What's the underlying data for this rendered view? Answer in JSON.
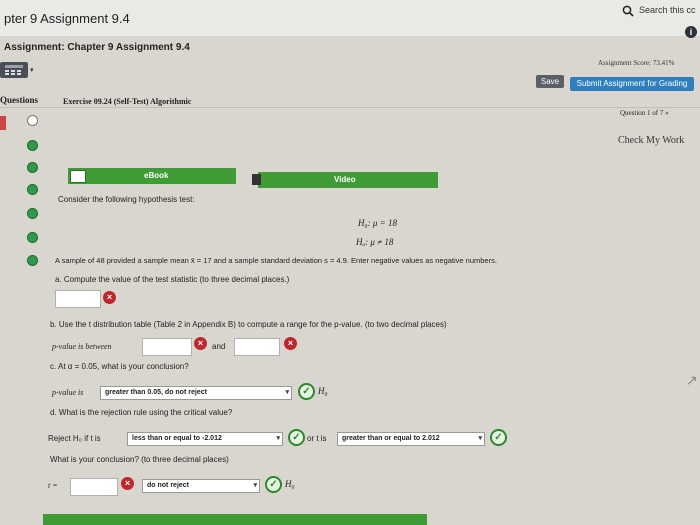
{
  "browser": {
    "search_placeholder": "Search this cc"
  },
  "header": {
    "page_title": "pter 9 Assignment 9.4",
    "assignment_title": "Assignment: Chapter 9 Assignment 9.4",
    "score": "Assignment Score: 73.41%",
    "save_label": "Save",
    "submit_label": "Submit Assignment for Grading",
    "info_glyph": "i"
  },
  "nav": {
    "questions_label": "Questions",
    "exercise_title": "Exercise 09.24 (Self-Test) Algorithmic",
    "question_num": "Question 1 of 7 »",
    "check_work": "Check My Work"
  },
  "resources": {
    "ebook_label": "eBook",
    "video_label": "Video"
  },
  "question": {
    "intro": "Consider the following hypothesis test:",
    "h0": "H₀: μ = 18",
    "ha": "Hₐ: μ ≠ 18",
    "sample_text": "A sample of 48 provided a sample mean x̄ = 17 and a sample standard deviation s = 4.9. Enter negative values as negative numbers.",
    "part_a": "a. Compute the value of the test statistic (to three decimal places.)",
    "part_b": "b. Use the t distribution table (Table 2 in Appendix B) to compute a range for the p-value. (to two decimal places)",
    "pvalue_between": "p-value is between",
    "and_label": "and",
    "part_c": "c. At α = 0.05, what is your conclusion?",
    "pvalue_is": "p-value is",
    "pvalue_select": "greater than 0.05, do not reject",
    "h0_label": "H₀",
    "part_d": "d. What is the rejection rule using the critical value?",
    "reject_label": "Reject H₀ if t is",
    "reject_select_1": "less than or equal to -2.012",
    "or_t_is": "or t is",
    "reject_select_2": "greater than or equal to 2.012",
    "conclusion_q": "What is your conclusion? (to three decimal places)",
    "t_label": "t =",
    "conclusion_select": "do not reject",
    "h0_label_2": "H₀",
    "wrong_glyph": "×",
    "right_glyph": "✓",
    "caret_glyph": "▾"
  },
  "icons": {
    "search": "search-icon",
    "info": "info-icon",
    "calculator": "calculator-icon",
    "ebook": "book-icon",
    "video": "video-icon",
    "status_correct": "check-circle-icon",
    "status_wrong": "x-circle-icon"
  },
  "colors": {
    "green": "#3f9b34",
    "blue": "#2d7fbd",
    "red": "#c0272d"
  }
}
